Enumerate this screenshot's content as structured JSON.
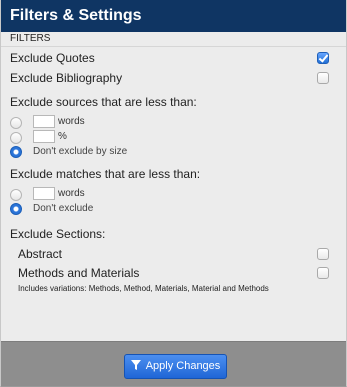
{
  "title": "Filters & Settings",
  "filters_header": "FILTERS",
  "exclude_quotes": {
    "label": "Exclude Quotes",
    "checked": true
  },
  "exclude_bibliography": {
    "label": "Exclude Bibliography",
    "checked": false
  },
  "sources": {
    "heading": "Exclude sources that are less than:",
    "words_unit": "words",
    "percent_unit": "%",
    "dont_exclude_label": "Don't exclude by size",
    "words_value": "",
    "percent_value": ""
  },
  "matches": {
    "heading": "Exclude matches that are less than:",
    "words_unit": "words",
    "dont_exclude_label": "Don't exclude",
    "words_value": ""
  },
  "sections": {
    "heading": "Exclude Sections:",
    "abstract_label": "Abstract",
    "methods_label": "Methods and Materials",
    "variations_note": "Includes variations: Methods, Method, Materials, Material and Methods"
  },
  "apply_button_label": "Apply Changes",
  "icons": {
    "funnel": "funnel-icon",
    "checkmark": "checkmark-icon"
  },
  "colors": {
    "title_bar": "#0f3563",
    "accent": "#2a74d9",
    "footer": "#8e8e8e"
  }
}
